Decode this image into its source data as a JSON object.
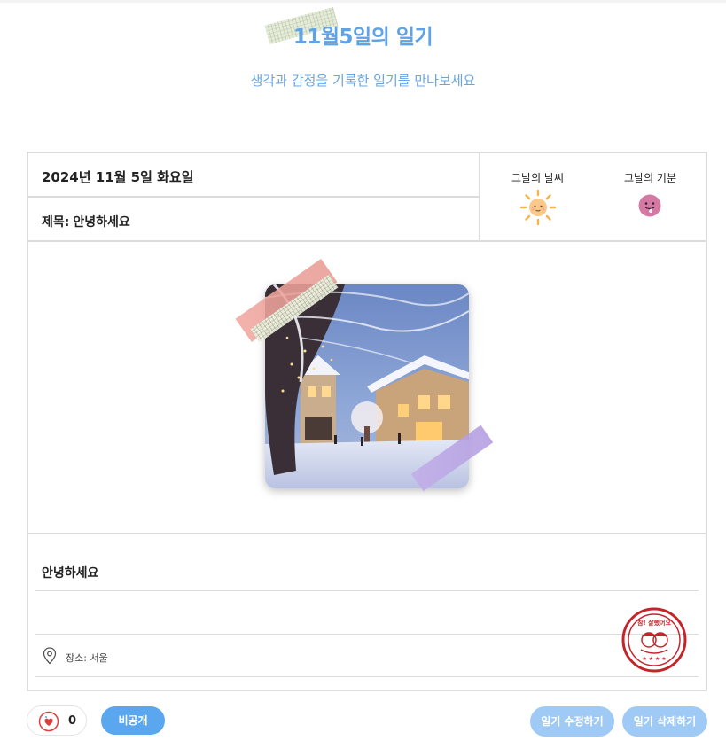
{
  "header": {
    "title": "11월5일의 일기",
    "subtitle": "생각과 감정을 기록한 일기를 만나보세요"
  },
  "diary": {
    "date": "2024년 11월 5일 화요일",
    "title_prefix": "제목:",
    "title": "안녕하세요",
    "weather_label": "그날의 날씨",
    "weather_icon": "sun-icon",
    "mood_label": "그날의 기분",
    "mood_icon": "tongue-out-face-icon",
    "photo_description_icon": "winter-village-photo",
    "content": "안녕하세요",
    "location": "장소: 서울",
    "stamp_text": "참! 잘했어요"
  },
  "footer": {
    "like_icon": "heart-sticker-icon",
    "like_count": "0",
    "visibility_label": "비공개",
    "edit_label": "일기 수정하기",
    "delete_label": "일기 삭제하기"
  },
  "colors": {
    "title_blue": "#5fa3e6",
    "button_blue": "#5aa7ef",
    "button_light_blue": "#9fcaf5",
    "stamp_red": "#c4252b"
  }
}
